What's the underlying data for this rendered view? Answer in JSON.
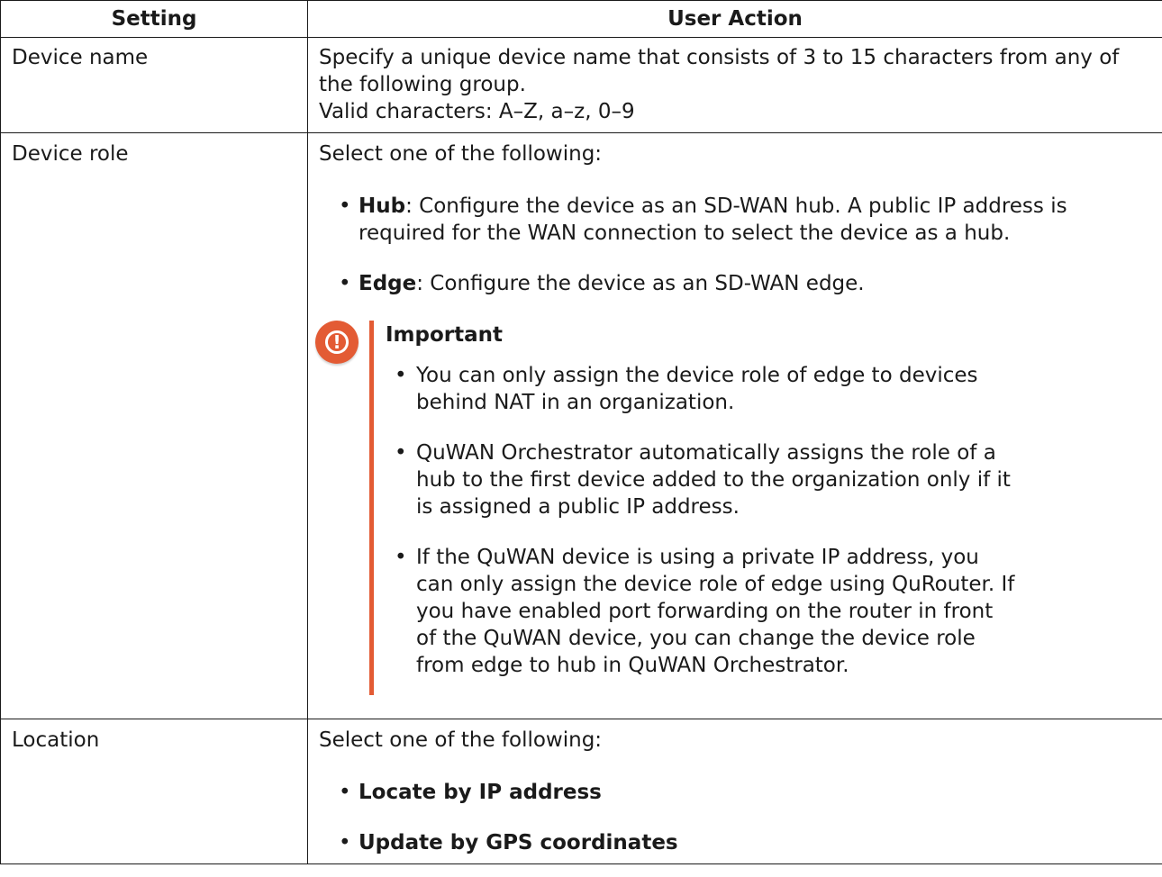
{
  "table": {
    "headers": [
      "Setting",
      "User Action"
    ],
    "rows": [
      {
        "setting": "Device name",
        "action_lines": [
          "Specify a unique device name that consists of 3 to 15 characters from any of the following group.",
          "Valid characters: A–Z, a–z, 0–9"
        ]
      },
      {
        "setting": "Device role",
        "intro": "Select one of the following:",
        "options": [
          {
            "term": "Hub",
            "desc": ": Configure the device as an SD-WAN hub. A public IP address is required for the WAN connection to select the device as a hub."
          },
          {
            "term": "Edge",
            "desc": ": Configure the device as an SD-WAN edge."
          }
        ],
        "important": {
          "title": "Important",
          "items": [
            "You can only assign the device role of edge to devices behind NAT in an organization.",
            "QuWAN Orchestrator automatically assigns the role of a hub to the first device added to the organization only if it is assigned a public IP address.",
            "If the QuWAN device is using a private IP address, you can only assign the device role of edge using QuRouter. If you have enabled port forwarding on the router in front of the QuWAN device, you can change the device role from edge to hub in QuWAN Orchestrator."
          ]
        }
      },
      {
        "setting": "Location",
        "intro": "Select one of the following:",
        "options": [
          {
            "term": "Locate by IP address"
          },
          {
            "term": "Update by GPS coordinates"
          }
        ]
      }
    ]
  },
  "bullet_glyph": "•",
  "important_icon": {
    "name": "warning-icon",
    "glyph": "!",
    "color": "#e35b34"
  }
}
